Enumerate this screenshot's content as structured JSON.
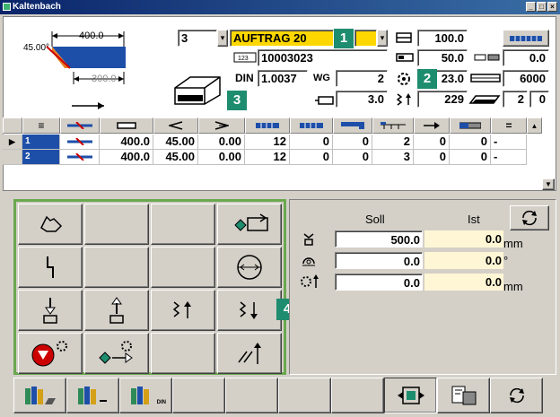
{
  "window": {
    "title": "Kaltenbach"
  },
  "profile": {
    "dim_top": "400.0",
    "angle": "45.00°",
    "dim_bottom": "300.0"
  },
  "header": {
    "selector_value": "3",
    "order_name": "AUFTRAG 20",
    "article_number": "10003023",
    "din_label": "DIN",
    "din_value": "1.0037",
    "wg_label": "WG",
    "wg_value": "2",
    "thickness_value": "3.0"
  },
  "params": {
    "height": "100.0",
    "width": "50.0",
    "feed": "23.0",
    "speed": "229",
    "right_top": "0.0",
    "length": "6000",
    "count_a": "2",
    "count_b": "0"
  },
  "badges": [
    "1",
    "2",
    "3",
    "4"
  ],
  "table": {
    "rows": [
      {
        "num": "1",
        "length": "400.0",
        "angle": "45.00",
        "offset": "0.00",
        "c1": "12",
        "c2": "0",
        "c3": "0",
        "c4": "2",
        "c5": "0",
        "c6": "0",
        "c7": "-"
      },
      {
        "num": "2",
        "length": "400.0",
        "angle": "45.00",
        "offset": "0.00",
        "c1": "12",
        "c2": "0",
        "c3": "0",
        "c4": "3",
        "c5": "0",
        "c6": "0",
        "c7": "-"
      }
    ]
  },
  "status": {
    "soll_label": "Soll",
    "ist_label": "Ist",
    "rows": [
      {
        "soll": "500.0",
        "ist": "0.0",
        "unit": "mm"
      },
      {
        "soll": "0.0",
        "ist": "0.0",
        "unit": "°"
      },
      {
        "soll": "0.0",
        "ist": "0.0",
        "unit": "mm"
      }
    ]
  },
  "bottom": {
    "din_tag": "DIN"
  },
  "colors": {
    "accent_green": "#1e8c6e",
    "order_yellow": "#ffd700",
    "ist_bg": "#fff6d5"
  }
}
